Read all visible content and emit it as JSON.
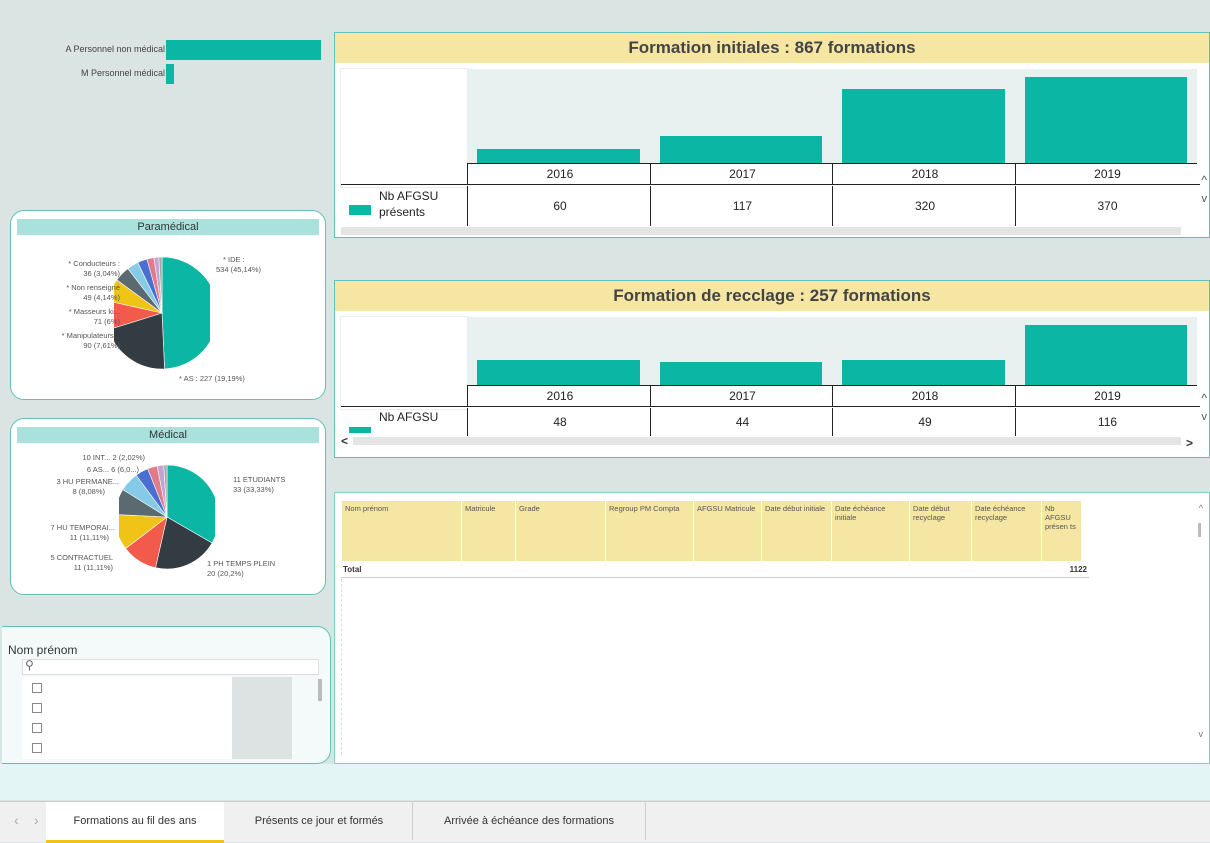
{
  "colors": {
    "teal": "#0cb6a4",
    "yellow_header": "#f5e6a3",
    "panel_border": "#5fc2b8",
    "panel_title_bg": "#a9e2dc",
    "pie_slices": [
      "#0cb6a4",
      "#333c42",
      "#f25a4c",
      "#f0c417",
      "#5b6a70",
      "#85cbe8",
      "#4a6fd1",
      "#e07b8c",
      "#c2a3d1",
      "#a6a6a6"
    ]
  },
  "personnel_filter": {
    "items": [
      {
        "label": "A Personnel non médical",
        "value": 1
      },
      {
        "label": "M Personnel médical",
        "value": 0.05
      }
    ]
  },
  "paramedical": {
    "title": "Paramédical",
    "labels": {
      "conducteurs": "* Conducteurs :",
      "conducteurs_val": "36 (3,04%)",
      "non_renseigne": "* Non renseigné",
      "non_renseigne_val": "49 (4,14%)",
      "masseurs": "* Masseurs ki...",
      "masseurs_val": "71 (6%)",
      "manipulateurs": "* Manipulateurs...",
      "manipulateurs_val": "90 (7,61%)",
      "ide": "* IDE :",
      "ide_val": "534 (45,14%)",
      "as": "* AS : 227 (19,19%)"
    },
    "slices": [
      534,
      227,
      90,
      71,
      49,
      36,
      30,
      22,
      15,
      10
    ]
  },
  "medical": {
    "title": "Médical",
    "labels": {
      "int": "10 INT... 2 (2,02%)",
      "as": "6 AS... 6 (6,0...)",
      "hu_perm": "3 HU PERMANE...",
      "hu_perm_val": "8 (8,08%)",
      "hu_temp": "7 HU TEMPORAI...",
      "hu_temp_val": "11 (11,11%)",
      "contractuel": "5 CONTRACTUEL",
      "contractuel_val": "11 (11,11%)",
      "etudiants": "11 ETUDIANTS",
      "etudiants_val": "33 (33,33%)",
      "ph": "1 PH TEMPS PLEIN",
      "ph_val": "20 (20,2%)"
    },
    "slices": [
      33,
      20,
      11,
      11,
      8,
      6,
      4,
      3,
      2,
      1
    ]
  },
  "name_filter": {
    "title": "Nom prénom",
    "search_icon": "search-icon",
    "search_placeholder": ""
  },
  "chart_data": [
    {
      "type": "bar",
      "title": "Formation initiales : 867 formations",
      "categories": [
        "2016",
        "2017",
        "2018",
        "2019"
      ],
      "series": [
        {
          "name": "Nb AFGSU présents",
          "values": [
            60,
            117,
            320,
            370
          ]
        }
      ],
      "ylim": [
        0,
        370
      ]
    },
    {
      "type": "bar",
      "title": "Formation de recclage : 257 formations",
      "categories": [
        "2016",
        "2017",
        "2018",
        "2019"
      ],
      "series": [
        {
          "name": "Nb AFGSU présents",
          "values": [
            48,
            44,
            49,
            116
          ]
        }
      ],
      "ylim": [
        0,
        116
      ]
    }
  ],
  "chart_labels": {
    "initial_title": "Formation initiales : 867 formations",
    "recyclage_title": "Formation de recclage : 257 formations",
    "row_label_line1": "Nb AFGSU",
    "row_label_line2": "présents",
    "scroll_left": "<",
    "scroll_right": ">",
    "scroll_up": "^",
    "scroll_down": "v"
  },
  "table": {
    "columns": [
      "Nom prénom",
      "Matricule",
      "Grade",
      "Regroup PM Compta",
      "AFGSU Matricule",
      "Date début initiale",
      "Date échéance initiale",
      "Date début recyclage",
      "Date échéance recyclage",
      "Nb AFGSU présen ts"
    ],
    "total_label": "Total",
    "total_value": "1122"
  },
  "tabs": [
    {
      "label": "Formations au fil des ans",
      "active": true
    },
    {
      "label": "Présents ce jour et formés",
      "active": false
    },
    {
      "label": "Arrivée à échéance des formations",
      "active": false
    }
  ],
  "nav_arrows": {
    "prev": "‹",
    "next": "›"
  }
}
